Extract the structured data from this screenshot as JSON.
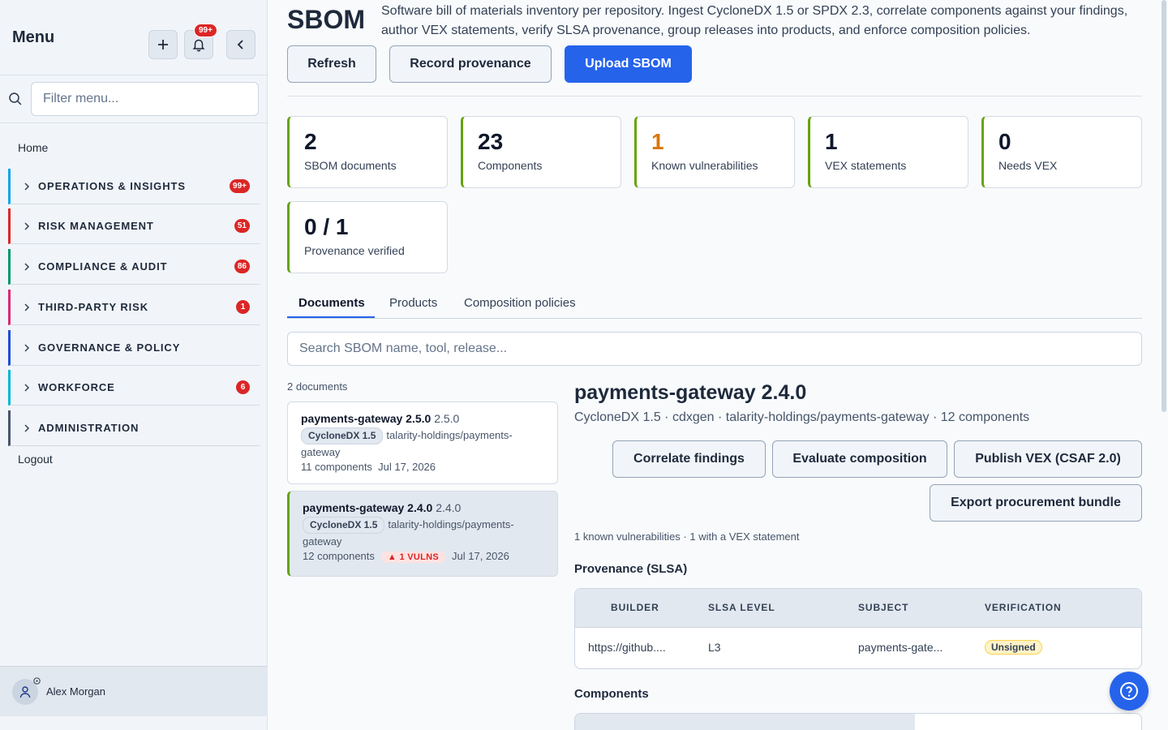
{
  "sidebar": {
    "title": "Menu",
    "notif_count": "99+",
    "filter_placeholder": "Filter menu...",
    "home": "Home",
    "items": [
      {
        "label": "OPERATIONS & INSIGHTS",
        "badge": "99+",
        "color": "#0ea5e9"
      },
      {
        "label": "RISK MANAGEMENT",
        "badge": "51",
        "color": "#dc2626"
      },
      {
        "label": "COMPLIANCE & AUDIT",
        "badge": "86",
        "color": "#059669"
      },
      {
        "label": "THIRD-PARTY RISK",
        "badge": "1",
        "color": "#db2777"
      },
      {
        "label": "GOVERNANCE & POLICY",
        "badge": "",
        "color": "#1d4ed8"
      },
      {
        "label": "WORKFORCE",
        "badge": "6",
        "color": "#06b6d4"
      },
      {
        "label": "ADMINISTRATION",
        "badge": "",
        "color": "#475569"
      }
    ],
    "logout": "Logout",
    "user": "Alex Morgan"
  },
  "header": {
    "title": "SBOM",
    "description": "Software bill of materials inventory per repository. Ingest CycloneDX 1.5 or SPDX 2.3, correlate components against your findings, author VEX statements, verify SLSA provenance, group releases into products, and enforce composition policies.",
    "refresh": "Refresh",
    "record": "Record provenance",
    "upload": "Upload SBOM"
  },
  "stats": [
    {
      "value": "2",
      "label": "SBOM documents"
    },
    {
      "value": "23",
      "label": "Components"
    },
    {
      "value": "1",
      "label": "Known vulnerabilities"
    },
    {
      "value": "1",
      "label": "VEX statements"
    },
    {
      "value": "0",
      "label": "Needs VEX"
    },
    {
      "value": "0 / 1",
      "label": "Provenance verified"
    }
  ],
  "tabs": [
    "Documents",
    "Products",
    "Composition policies"
  ],
  "search_placeholder": "Search SBOM name, tool, release...",
  "doc_count": "2 documents",
  "documents": [
    {
      "name": "payments-gateway 2.5.0",
      "version": "2.5.0",
      "format": "CycloneDX 1.5",
      "repo": "talarity-holdings/payments-gateway",
      "components": "11 components",
      "vulns": "",
      "date": "Jul 17, 2026"
    },
    {
      "name": "payments-gateway 2.4.0",
      "version": "2.4.0",
      "format": "CycloneDX 1.5",
      "repo": "talarity-holdings/payments-gateway",
      "components": "12 components",
      "vulns": "▲ 1 VULNS",
      "date": "Jul 17, 2026"
    }
  ],
  "detail": {
    "title": "payments-gateway 2.4.0",
    "subtitle": "CycloneDX 1.5 · cdxgen · talarity-holdings/payments-gateway · 12 components",
    "correlate": "Correlate findings",
    "evaluate": "Evaluate composition",
    "publish": "Publish VEX (CSAF 2.0)",
    "export": "Export procurement bundle",
    "vuln_line": "1 known vulnerabilities · 1 with a VEX statement",
    "provenance_heading": "Provenance (SLSA)",
    "prov_columns": [
      "BUILDER",
      "SLSA LEVEL",
      "SUBJECT",
      "VERIFICATION"
    ],
    "prov_row": {
      "builder": "https://github....",
      "level": "L3",
      "subject": "payments-gate...",
      "verification": "Unsigned"
    },
    "components_heading": "Components"
  }
}
